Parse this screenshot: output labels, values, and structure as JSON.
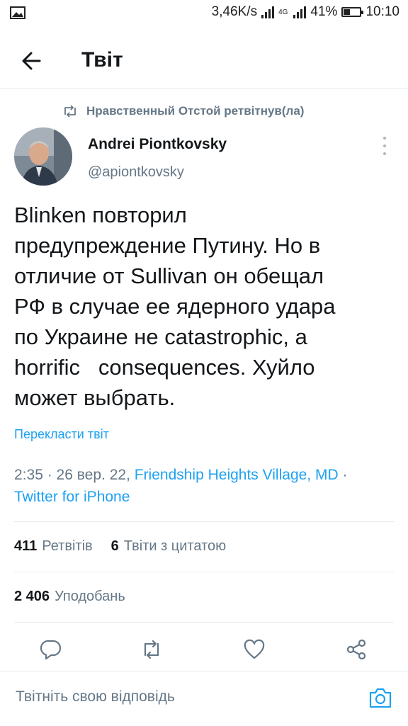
{
  "status_bar": {
    "speed": "3,46K/s",
    "network": "4G",
    "battery_percent": "41%",
    "battery_level": 0.41,
    "time": "10:10"
  },
  "header": {
    "title": "Твіт",
    "back_icon": "arrow-left-icon"
  },
  "retweet": {
    "text": "Нравственный Отстой ретвітнув(ла)",
    "icon": "retweet-icon"
  },
  "author": {
    "name": "Andrei Piontkovsky",
    "handle": "@apiontkovsky"
  },
  "tweet": {
    "text": "Blinken повторил\nпредупреждение Путину. Но в\nотличие от Sullivan он обещал\nРФ в случае ее ядерного удара\nпо Украине не catastrophic, а\nhorrific   consequences. Хуйло\nможет выбрать.",
    "translate_label": "Перекласти твіт"
  },
  "meta": {
    "time": "2:35",
    "sep1": " · ",
    "date": "26 вер. 22",
    "comma": ", ",
    "location": "Friendship Heights Village, MD",
    "sep2": " · ",
    "source": "Twitter for iPhone"
  },
  "stats": {
    "retweets_count": "411",
    "retweets_label": "Ретвітів",
    "quotes_count": "6",
    "quotes_label": "Твіти з цитатою",
    "likes_count": "2 406",
    "likes_label": "Уподобань"
  },
  "actions": [
    "reply-icon",
    "retweet-icon",
    "like-icon",
    "share-icon"
  ],
  "reply_bar": {
    "placeholder": "Твітніть свою відповідь",
    "camera_icon": "camera-icon"
  },
  "colors": {
    "accent": "#1da1f2",
    "secondary_text": "#657786",
    "primary_text": "#14171a",
    "divider": "#e6ecf0"
  }
}
